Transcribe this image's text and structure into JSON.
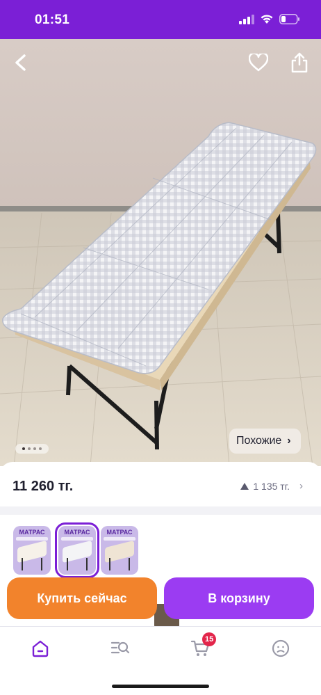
{
  "status_bar": {
    "time": "01:51",
    "icons": [
      "signal-icon",
      "wifi-icon",
      "battery-icon"
    ]
  },
  "hero": {
    "back_icon": "back-icon",
    "favorite_icon": "heart-icon",
    "share_icon": "share-icon",
    "gallery_dots": {
      "count": 4,
      "active_index": 0
    },
    "similar_label": "Похожие"
  },
  "price": {
    "current": "11 260 тг.",
    "delta": "1 135 тг."
  },
  "variants": {
    "items": [
      {
        "label": "МАТРАС",
        "selected": false
      },
      {
        "label": "МАТРАС",
        "selected": true
      },
      {
        "label": "МАТРАС",
        "selected": false
      }
    ]
  },
  "actions": {
    "buy_now": "Купить сейчас",
    "add_to_cart": "В корзину"
  },
  "bottom_nav": {
    "items": [
      "home-icon",
      "catalog-search-icon",
      "cart-icon",
      "profile-icon"
    ],
    "cart_badge": "15"
  },
  "colors": {
    "brand_purple": "#7b1fd6",
    "buy_now_orange": "#f2832c",
    "add_cart_purple": "#9b3cf2",
    "badge_red": "#e3264b"
  }
}
